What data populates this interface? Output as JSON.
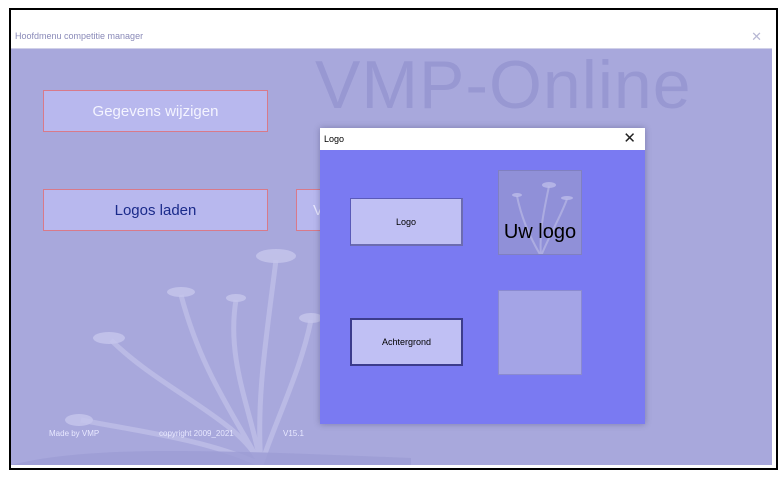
{
  "main_window": {
    "title": "Hoofdmenu competitie manager",
    "close_glyph": "✕",
    "brand": "VMP-Online",
    "buttons": {
      "gegevens": "Gegevens wijzigen",
      "logos": "Logos laden",
      "partial": "V"
    },
    "footer": {
      "made_by": "Made by VMP",
      "copyright": "copyright 2009_2021",
      "version": "V15.1"
    }
  },
  "dialog": {
    "title": "Logo",
    "close_glyph": "✕",
    "logo_button": "Logo",
    "background_button": "Achtergrond",
    "logo_preview_text": "Uw logo"
  },
  "colors": {
    "main_bg": "#a8a8dc",
    "dialog_bg": "#7a7af2",
    "button_bg": "#b8b8ee",
    "button_border": "#d87a8a"
  }
}
